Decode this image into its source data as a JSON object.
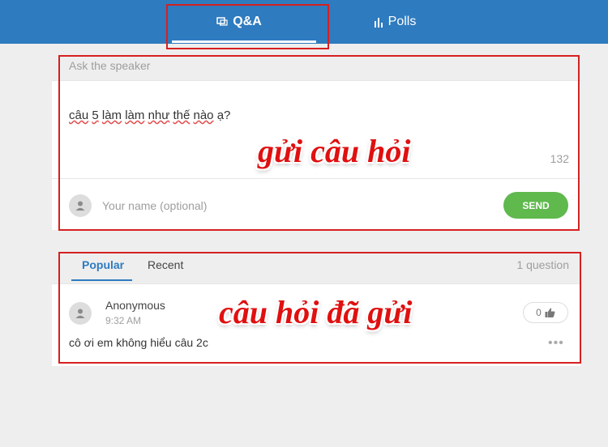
{
  "tabs": {
    "qa_label": "Q&A",
    "polls_label": "Polls"
  },
  "ask": {
    "label": "Ask the speaker",
    "question_words": [
      "câu",
      "5",
      "làm",
      "làm",
      "như",
      "thế",
      "nào",
      "ạ?"
    ],
    "char_count": "132",
    "name_placeholder": "Your name (optional)",
    "send_label": "SEND"
  },
  "list": {
    "tab_popular": "Popular",
    "tab_recent": "Recent",
    "count": "1 question",
    "questions": [
      {
        "author": "Anonymous",
        "time": "9:32 AM",
        "text": "cô ơi em không hiểu câu 2c",
        "likes": "0"
      }
    ]
  },
  "annotations": {
    "send_note": "gửi câu hỏi",
    "sent_note": "câu hỏi đã gửi"
  },
  "colors": {
    "topbar": "#2e7bbf",
    "send_button": "#5fb94d",
    "annotation": "#d62020"
  },
  "icons": {
    "qa_tab": "chat-bubbles-icon",
    "polls_tab": "bar-chart-icon",
    "avatar": "user-icon",
    "like": "thumbs-up-icon",
    "more": "more-dots-icon"
  }
}
